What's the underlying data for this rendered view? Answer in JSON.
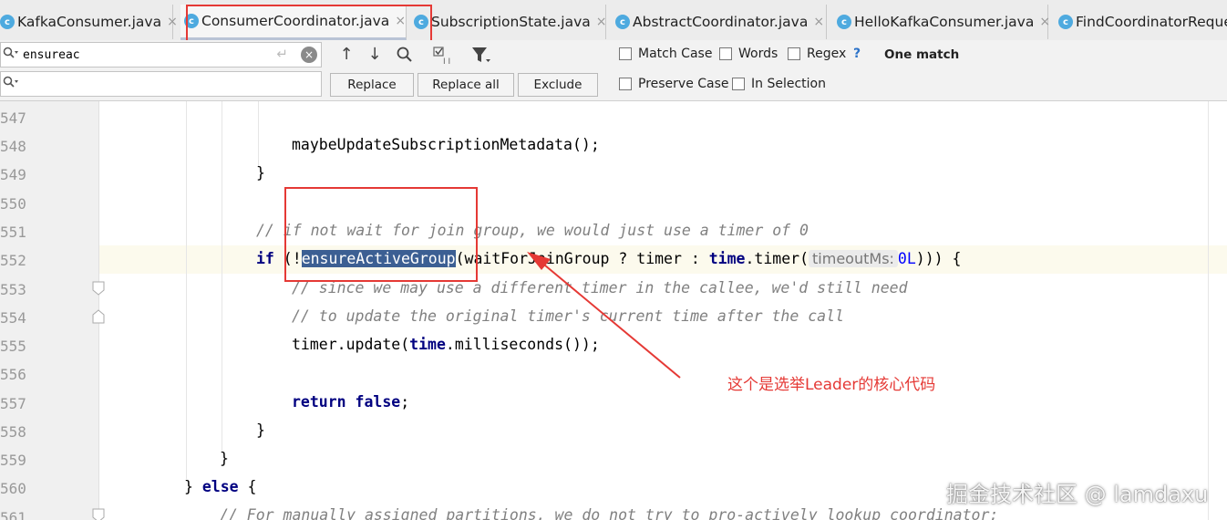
{
  "tabs": [
    {
      "label": "KafkaConsumer.java",
      "close": "×"
    },
    {
      "label": "ConsumerCoordinator.java",
      "close": "×"
    },
    {
      "label": "SubscriptionState.java",
      "close": "×"
    },
    {
      "label": "AbstractCoordinator.java",
      "close": "×"
    },
    {
      "label": "HelloKafkaConsumer.java",
      "close": "×"
    },
    {
      "label": "FindCoordinatorReque",
      "close": ""
    }
  ],
  "find": {
    "search_value": "ensureac",
    "replace_value": "",
    "replace_label": "Replace",
    "replace_all_label": "Replace all",
    "exclude_label": "Exclude",
    "match_case": "Match Case",
    "words": "Words",
    "regex": "Regex",
    "regex_help": "?",
    "preserve_case": "Preserve Case",
    "in_selection": "In Selection",
    "result": "One match"
  },
  "editor": {
    "line_numbers": [
      "547",
      "548",
      "549",
      "550",
      "551",
      "552",
      "553",
      "554",
      "555",
      "556",
      "557",
      "558",
      "559",
      "560",
      "561"
    ],
    "code": {
      "l548": "maybeUpdateSubscriptionMetadata();",
      "l549": "}",
      "l551": "// if not wait for join group, we would just use a timer of 0",
      "l552_kw": "if",
      "l552_a": " (!",
      "l552_match": "ensureActiveGroup",
      "l552_b": "(waitForJoinGroup ? timer : ",
      "l552_time": "time",
      "l552_c": ".timer(",
      "l552_hint": "timeoutMs:",
      "l552_num": "0L",
      "l552_d": "))) {",
      "l553": "// since we may use a different timer in the callee, we'd still need",
      "l554": "// to update the original timer's current time after the call",
      "l555_a": "timer.update(",
      "l555_time": "time",
      "l555_b": ".milliseconds());",
      "l557_kw": "return false",
      "l557_b": ";",
      "l558": "}",
      "l559": "}",
      "l560_a": "} ",
      "l560_kw": "else",
      "l560_b": " {",
      "l561": "// For manually assigned partitions, we do not try to pro-actively lookup coordinator;"
    }
  },
  "annotation": "这个是选举Leader的核心代码",
  "watermark": "掘金技术社区 @ lamdaxu",
  "colors": {
    "annotation_red": "#e53935",
    "match_highlight": "#3c5f93",
    "keyword": "#000080"
  }
}
